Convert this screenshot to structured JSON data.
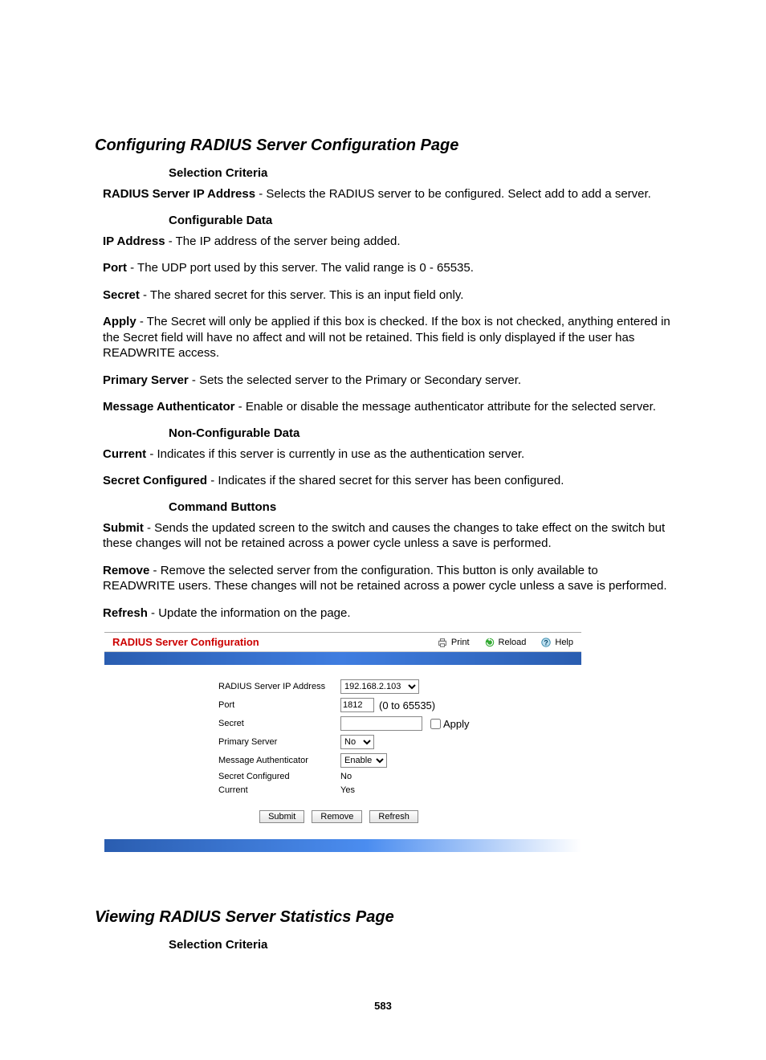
{
  "headings": {
    "h2a": "Configuring RADIUS Server Configuration Page",
    "h3a": "Selection Criteria",
    "h3b": "Configurable Data",
    "h3c": "Non-Configurable Data",
    "h3d": "Command Buttons",
    "h2b": "Viewing RADIUS Server Statistics Page",
    "h3e": "Selection Criteria"
  },
  "defs": {
    "radius_ip_b": "RADIUS Server IP Address",
    "radius_ip_t": " - Selects the RADIUS server to be configured. Select add to add a server.",
    "ip_b": "IP Address",
    "ip_t": " - The IP address of the server being added.",
    "port_b": "Port",
    "port_t": " - The UDP port used by this server. The valid range is 0 - 65535.",
    "secret_b": "Secret",
    "secret_t": " -   The shared secret for this server. This is an input field only.",
    "apply_b": "Apply",
    "apply_t": " - The Secret will only be applied if this box is checked. If the box is not checked, anything entered in the Secret field will have no affect and will not be retained. This field is only displayed if the user has READWRITE access.",
    "prim_b": "Primary Server",
    "prim_t": " - Sets the selected server to the Primary or Secondary server.",
    "msga_b": "Message Authenticator",
    "msga_t": " - Enable or disable the message authenticator attribute for the selected server.",
    "curr_b": "Current",
    "curr_t": " - Indicates if this server is currently in use as the authentication server.",
    "sconf_b": "Secret Configured",
    "sconf_t": " - Indicates if the shared secret for this server has been configured.",
    "submit_b": "Submit",
    "submit_t": " - Sends the updated screen to the switch and causes the changes to take effect on the switch but these changes will not be retained across a power cycle unless a save is performed.",
    "remove_b": "Remove",
    "remove_t": " - Remove the selected server from the configuration. This button is only available to READWRITE users. These changes will not be retained across a power cycle unless a save is performed.",
    "refresh_b": "Refresh",
    "refresh_t": " - Update the information on the page."
  },
  "shot": {
    "title": "RADIUS Server Configuration",
    "tools": {
      "print": "Print",
      "reload": "Reload",
      "help": "Help"
    },
    "labels": {
      "ip": "RADIUS Server IP Address",
      "port": "Port",
      "secret": "Secret",
      "primary": "Primary Server",
      "msgauth": "Message Authenticator",
      "sconf": "Secret Configured",
      "current": "Current"
    },
    "values": {
      "ip": "192.168.2.103",
      "port": "1812",
      "port_range": "(0 to 65535)",
      "secret": "",
      "apply_label": "Apply",
      "primary": "No",
      "msgauth": "Enable",
      "sconf": "No",
      "current": "Yes"
    },
    "buttons": {
      "submit": "Submit",
      "remove": "Remove",
      "refresh": "Refresh"
    }
  },
  "pagenum": "583"
}
